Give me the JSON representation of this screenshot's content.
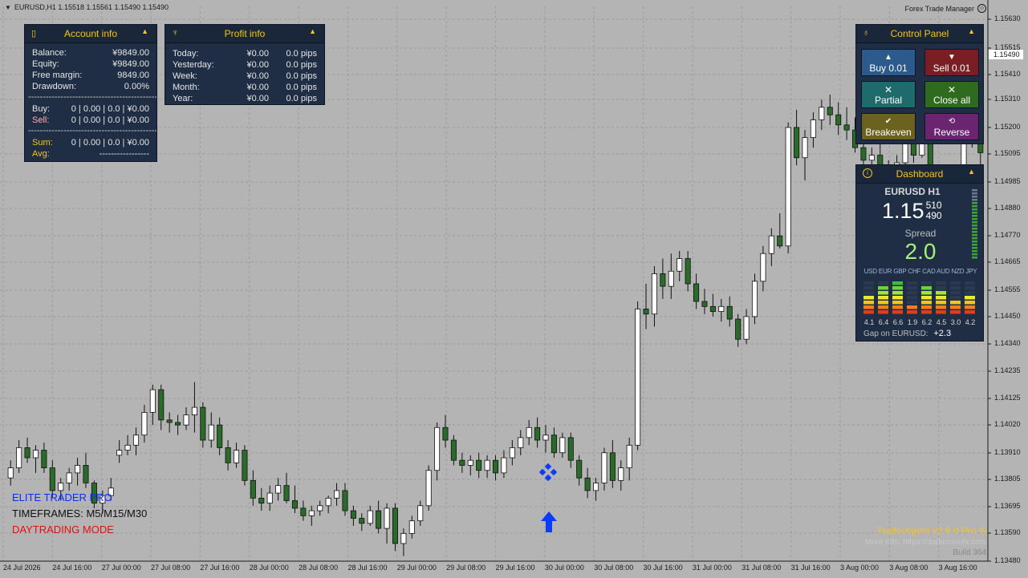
{
  "chart_header": "EURUSD,H1  1.15518 1.15561 1.15490 1.15490",
  "ea_title": "Forex Trade Manager",
  "price_axis": [
    "1.15630",
    "1.15515",
    "1.15410",
    "1.15310",
    "1.15200",
    "1.15095",
    "1.14985",
    "1.14880",
    "1.14770",
    "1.14665",
    "1.14555",
    "1.14450",
    "1.14340",
    "1.14235",
    "1.14125",
    "1.14020",
    "1.13910",
    "1.13805",
    "1.13695",
    "1.13590",
    "1.13480"
  ],
  "current_price_tag": "1.15490",
  "time_axis": [
    "24 Jul 2026",
    "24 Jul 16:00",
    "27 Jul 00:00",
    "27 Jul 08:00",
    "27 Jul 16:00",
    "28 Jul 00:00",
    "28 Jul 08:00",
    "28 Jul 16:00",
    "29 Jul 00:00",
    "29 Jul 08:00",
    "29 Jul 16:00",
    "30 Jul 00:00",
    "30 Jul 08:00",
    "30 Jul 16:00",
    "31 Jul 00:00",
    "31 Jul 08:00",
    "31 Jul 16:00",
    "3 Aug 00:00",
    "3 Aug 08:00",
    "3 Aug 16:00"
  ],
  "account": {
    "title": "Account info",
    "rows": [
      {
        "label": "Balance:",
        "value": "¥9849.00"
      },
      {
        "label": "Equity:",
        "value": "¥9849.00"
      },
      {
        "label": "Free margin:",
        "value": "9849.00"
      },
      {
        "label": "Drawdown:",
        "value": "0.00%"
      }
    ],
    "separator": "---------------------------------------------------",
    "buy_label": "Buy:",
    "buy_value": "0 | 0.00 | 0.0 | ¥0.00",
    "sell_label": "Sell:",
    "sell_value": "0 | 0.00 | 0.0 | ¥0.00",
    "sum_label": "Sum:",
    "sum_value": "0 | 0.00 | 0.0 | ¥0.00",
    "avg_label": "Avg:",
    "avg_value": "-----------------"
  },
  "profit": {
    "title": "Profit info",
    "rows": [
      {
        "label": "Today:",
        "money": "¥0.00",
        "pips": "0.0 pips"
      },
      {
        "label": "Yesterday:",
        "money": "¥0.00",
        "pips": "0.0 pips"
      },
      {
        "label": "Week:",
        "money": "¥0.00",
        "pips": "0.0 pips"
      },
      {
        "label": "Month:",
        "money": "¥0.00",
        "pips": "0.0 pips"
      },
      {
        "label": "Year:",
        "money": "¥0.00",
        "pips": "0.0 pips"
      }
    ]
  },
  "control": {
    "title": "Control Panel",
    "buy": "Buy 0.01",
    "sell": "Sell 0.01",
    "partial": "Partial",
    "close_all": "Close all",
    "breakeven": "Breakeven",
    "reverse": "Reverse"
  },
  "dashboard": {
    "title": "Dashboard",
    "symbol": "EURUSD H1",
    "price_main": "1.15",
    "price_ask": "510",
    "price_bid": "490",
    "spread_label": "Spread",
    "spread_value": "2.0",
    "currencies": "USD EUR GBP CHF CAD AUD NZD JPY",
    "strengths": [
      "4.1",
      "6.4",
      "6.6",
      "1.9",
      "6.2",
      "4.5",
      "3.0",
      "4.2"
    ],
    "strength_levels": [
      4.1,
      6.4,
      6.6,
      1.9,
      6.2,
      4.5,
      3.0,
      4.2
    ],
    "gap_label": "Gap on EURUSD:",
    "gap_value": "+2.3"
  },
  "left_overlay": {
    "line1": "ELITE TRADER PRO",
    "line2": "TIMEFRAMES: M5/M15/M30",
    "line3": "DAYTRADING MODE"
  },
  "branding": {
    "title": "TraderAgent v2.6.0 Pro ©",
    "more": "More info: https://darkmoonfx.com",
    "build": "Build 364"
  },
  "colors": {
    "bull": "#ffffff",
    "bear": "#2a6b2a",
    "buy_arrow": "#0a3cff"
  },
  "chart_data": {
    "type": "candlestick",
    "symbol": "EURUSD",
    "timeframe": "H1",
    "ylim": [
      1.1348,
      1.1568
    ],
    "candles": [
      [
        1.1381,
        1.1388,
        1.1378,
        1.1385
      ],
      [
        1.1385,
        1.1396,
        1.1383,
        1.1393
      ],
      [
        1.1393,
        1.1397,
        1.1387,
        1.1389
      ],
      [
        1.1389,
        1.1394,
        1.1383,
        1.1392
      ],
      [
        1.1392,
        1.1395,
        1.1383,
        1.1385
      ],
      [
        1.1385,
        1.1388,
        1.1373,
        1.1376
      ],
      [
        1.1376,
        1.1381,
        1.1372,
        1.1379
      ],
      [
        1.1379,
        1.1385,
        1.1376,
        1.1383
      ],
      [
        1.1383,
        1.1389,
        1.1378,
        1.1386
      ],
      [
        1.1386,
        1.1391,
        1.1377,
        1.1379
      ],
      [
        1.1379,
        1.138,
        1.1369,
        1.1371
      ],
      [
        1.1371,
        1.1376,
        1.1367,
        1.1374
      ],
      [
        1.1374,
        1.1381,
        1.1372,
        1.1377
      ],
      [
        1.139,
        1.1396,
        1.1387,
        1.1392
      ],
      [
        1.1392,
        1.1398,
        1.139,
        1.1394
      ],
      [
        1.1394,
        1.1401,
        1.139,
        1.1398
      ],
      [
        1.1398,
        1.141,
        1.1395,
        1.1407
      ],
      [
        1.1407,
        1.1418,
        1.1402,
        1.1416
      ],
      [
        1.1416,
        1.1418,
        1.14,
        1.1404
      ],
      [
        1.1404,
        1.1407,
        1.1399,
        1.1403
      ],
      [
        1.1403,
        1.1406,
        1.1398,
        1.1402
      ],
      [
        1.1402,
        1.1409,
        1.14,
        1.1406
      ],
      [
        1.1406,
        1.1419,
        1.1399,
        1.1409
      ],
      [
        1.1409,
        1.1411,
        1.1393,
        1.1396
      ],
      [
        1.1396,
        1.1407,
        1.1393,
        1.1402
      ],
      [
        1.1402,
        1.1405,
        1.139,
        1.1393
      ],
      [
        1.1393,
        1.1396,
        1.1384,
        1.1387
      ],
      [
        1.1387,
        1.1395,
        1.1385,
        1.1392
      ],
      [
        1.1392,
        1.1394,
        1.1378,
        1.138
      ],
      [
        1.138,
        1.1384,
        1.137,
        1.1373
      ],
      [
        1.1373,
        1.1377,
        1.1368,
        1.1371
      ],
      [
        1.1371,
        1.1378,
        1.1368,
        1.1375
      ],
      [
        1.1375,
        1.1381,
        1.1372,
        1.1378
      ],
      [
        1.1378,
        1.1383,
        1.1371,
        1.1372
      ],
      [
        1.1372,
        1.1378,
        1.1367,
        1.1369
      ],
      [
        1.1369,
        1.1372,
        1.1364,
        1.1366
      ],
      [
        1.1366,
        1.137,
        1.1362,
        1.1368
      ],
      [
        1.1368,
        1.1372,
        1.1366,
        1.137
      ],
      [
        1.137,
        1.1374,
        1.1367,
        1.1373
      ],
      [
        1.1373,
        1.1379,
        1.137,
        1.1376
      ],
      [
        1.1376,
        1.1379,
        1.1366,
        1.1368
      ],
      [
        1.1368,
        1.137,
        1.1362,
        1.1365
      ],
      [
        1.1365,
        1.1367,
        1.136,
        1.1363
      ],
      [
        1.1363,
        1.137,
        1.1362,
        1.1368
      ],
      [
        1.1368,
        1.1372,
        1.1359,
        1.1361
      ],
      [
        1.1361,
        1.1371,
        1.1355,
        1.1369
      ],
      [
        1.1369,
        1.1371,
        1.1352,
        1.1355
      ],
      [
        1.1355,
        1.1361,
        1.135,
        1.1359
      ],
      [
        1.1359,
        1.1366,
        1.1357,
        1.1364
      ],
      [
        1.1364,
        1.1372,
        1.1362,
        1.137
      ],
      [
        1.137,
        1.1386,
        1.1368,
        1.1384
      ],
      [
        1.1384,
        1.1403,
        1.138,
        1.1401
      ],
      [
        1.1401,
        1.1406,
        1.1393,
        1.1396
      ],
      [
        1.1396,
        1.1398,
        1.1386,
        1.1388
      ],
      [
        1.1388,
        1.1391,
        1.1383,
        1.1386
      ],
      [
        1.1386,
        1.139,
        1.1382,
        1.1388
      ],
      [
        1.1388,
        1.1391,
        1.1381,
        1.1384
      ],
      [
        1.1384,
        1.139,
        1.1381,
        1.1388
      ],
      [
        1.1388,
        1.139,
        1.138,
        1.1383
      ],
      [
        1.1383,
        1.1392,
        1.1381,
        1.1389
      ],
      [
        1.1389,
        1.1396,
        1.1386,
        1.1393
      ],
      [
        1.1393,
        1.14,
        1.139,
        1.1397
      ],
      [
        1.1397,
        1.1404,
        1.1394,
        1.1401
      ],
      [
        1.1401,
        1.1405,
        1.1393,
        1.1396
      ],
      [
        1.1396,
        1.1402,
        1.1391,
        1.1398
      ],
      [
        1.1398,
        1.1401,
        1.1389,
        1.1391
      ],
      [
        1.1391,
        1.1399,
        1.1389,
        1.1397
      ],
      [
        1.1397,
        1.1399,
        1.1385,
        1.1388
      ],
      [
        1.1388,
        1.139,
        1.1378,
        1.1381
      ],
      [
        1.1381,
        1.1385,
        1.1373,
        1.1376
      ],
      [
        1.1376,
        1.1381,
        1.1372,
        1.1379
      ],
      [
        1.1379,
        1.1393,
        1.1376,
        1.1391
      ],
      [
        1.1391,
        1.1396,
        1.1377,
        1.138
      ],
      [
        1.138,
        1.1388,
        1.1376,
        1.1385
      ],
      [
        1.1385,
        1.1397,
        1.138,
        1.1394
      ],
      [
        1.1394,
        1.1451,
        1.1392,
        1.1448
      ],
      [
        1.1448,
        1.1458,
        1.144,
        1.1446
      ],
      [
        1.1446,
        1.1465,
        1.1441,
        1.1462
      ],
      [
        1.1462,
        1.1468,
        1.1452,
        1.1457
      ],
      [
        1.1457,
        1.147,
        1.1452,
        1.1463
      ],
      [
        1.1463,
        1.1471,
        1.1459,
        1.1468
      ],
      [
        1.1468,
        1.1471,
        1.1455,
        1.1458
      ],
      [
        1.1458,
        1.1462,
        1.1448,
        1.1451
      ],
      [
        1.1451,
        1.1456,
        1.1446,
        1.1449
      ],
      [
        1.1449,
        1.1454,
        1.1445,
        1.1447
      ],
      [
        1.1447,
        1.1452,
        1.1443,
        1.1449
      ],
      [
        1.1449,
        1.1453,
        1.1441,
        1.1444
      ],
      [
        1.1444,
        1.1446,
        1.1433,
        1.1436
      ],
      [
        1.1436,
        1.1448,
        1.1434,
        1.1445
      ],
      [
        1.1445,
        1.1462,
        1.1442,
        1.1459
      ],
      [
        1.1459,
        1.1473,
        1.1455,
        1.147
      ],
      [
        1.147,
        1.148,
        1.1465,
        1.1477
      ],
      [
        1.1477,
        1.1486,
        1.1472,
        1.1473
      ],
      [
        1.1473,
        1.1522,
        1.147,
        1.152
      ],
      [
        1.152,
        1.1527,
        1.1505,
        1.1508
      ],
      [
        1.1508,
        1.1519,
        1.1499,
        1.1516
      ],
      [
        1.1516,
        1.1526,
        1.1512,
        1.1523
      ],
      [
        1.1523,
        1.1531,
        1.1519,
        1.1528
      ],
      [
        1.1528,
        1.1533,
        1.1521,
        1.1525
      ],
      [
        1.1525,
        1.153,
        1.1517,
        1.1521
      ],
      [
        1.1521,
        1.1528,
        1.1515,
        1.1519
      ],
      [
        1.1519,
        1.1524,
        1.151,
        1.1512
      ],
      [
        1.1512,
        1.1516,
        1.1504,
        1.1507
      ],
      [
        1.1507,
        1.1512,
        1.1501,
        1.1509
      ],
      [
        1.1509,
        1.1514,
        1.15,
        1.1503
      ],
      [
        1.1503,
        1.1507,
        1.1497,
        1.15
      ],
      [
        1.15,
        1.1509,
        1.1496,
        1.1506
      ],
      [
        1.1506,
        1.1521,
        1.1504,
        1.1518
      ],
      [
        1.1518,
        1.1523,
        1.1506,
        1.1509
      ],
      [
        1.1509,
        1.1521,
        1.1508,
        1.1519
      ],
      [
        1.1519,
        1.1522,
        1.1496,
        1.1498
      ],
      [
        1.1498,
        1.1502,
        1.148,
        1.1484
      ],
      [
        1.1484,
        1.149,
        1.1458,
        1.1463
      ],
      [
        1.1463,
        1.1496,
        1.146,
        1.1494
      ],
      [
        1.1494,
        1.1524,
        1.149,
        1.152
      ],
      [
        1.152,
        1.1532,
        1.1512,
        1.1516
      ],
      [
        1.1516,
        1.1521,
        1.1505,
        1.151
      ]
    ]
  }
}
